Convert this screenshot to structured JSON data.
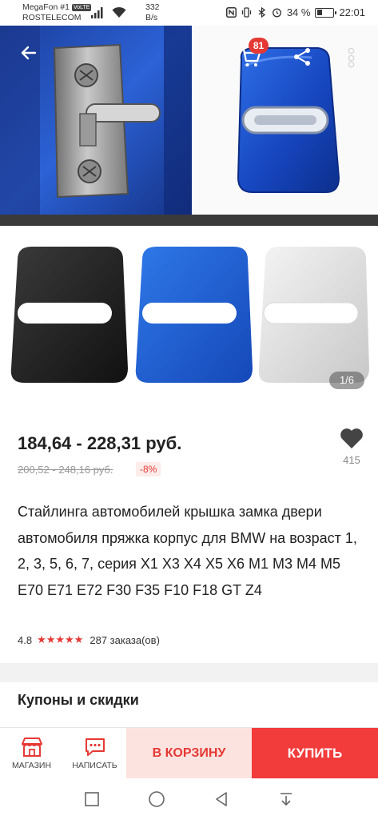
{
  "status_bar": {
    "carrier": "MegaFon #1",
    "carrier_tag": "VoLTE",
    "carrier2": "ROSTELECOM",
    "speed_value": "332",
    "speed_unit": "B/s",
    "battery": "34 %",
    "battery_level": 0.34,
    "time": "22:01"
  },
  "gallery": {
    "cart_count": "81",
    "page_indicator": "1/6"
  },
  "product": {
    "price_range": "184,64 - 228,31 руб.",
    "old_price_range": "200,52 - 248,16 руб.",
    "discount": "-8%",
    "wishlist_count": "415",
    "title": "Стайлинга автомобилей крышка замка двери автомобиля пряжка корпус для BMW на возраст 1, 2, 3, 5, 6, 7, серия X1 X3 X4 X5 X6 M1 M3 M4 M5 E70 E71 E72 F30 F35 F10 F18 GT Z4",
    "rating": "4.8",
    "stars": "★★★★★",
    "orders": "287 заказа(ов)"
  },
  "coupons": {
    "title": "Купоны и скидки"
  },
  "actions": {
    "store_label": "МАГАЗИН",
    "message_label": "НАПИСАТЬ",
    "add_to_cart": "В КОРЗИНУ",
    "buy": "КУПИТЬ"
  },
  "colors": {
    "accent": "#e53935",
    "buy_button": "#f23b3b",
    "cart_button_bg": "#fde3e0",
    "price_text": "#222222"
  },
  "icons": [
    "back-arrow-icon",
    "cart-icon",
    "share-icon",
    "more-vert-icon",
    "heart-icon",
    "store-icon",
    "chat-icon",
    "nav-recents-icon",
    "nav-home-icon",
    "nav-back-icon",
    "nav-notifications-icon"
  ]
}
